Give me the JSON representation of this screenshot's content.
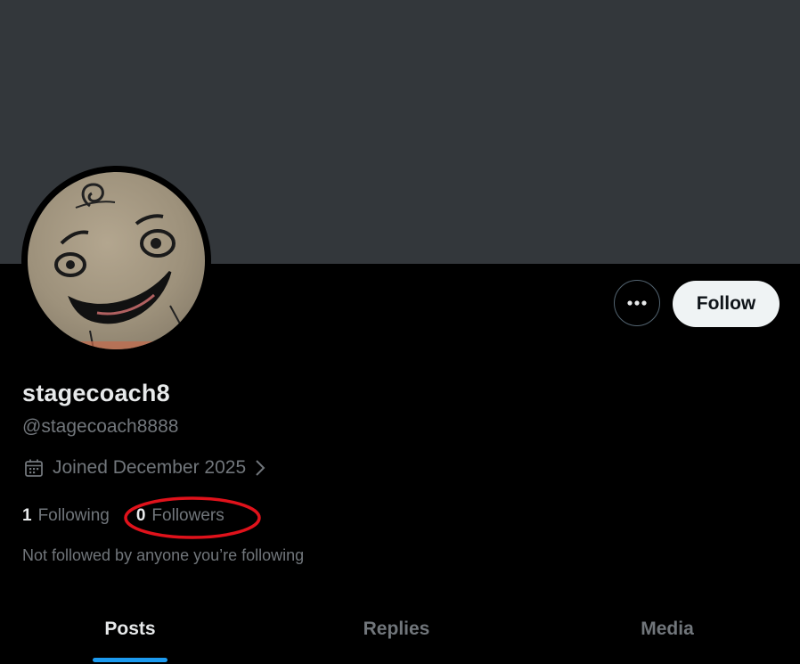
{
  "profile": {
    "display_name": "stagecoach8",
    "handle": "@stagecoach8888",
    "joined": "Joined December 2025",
    "following_count": "1",
    "following_label": "Following",
    "followers_count": "0",
    "followers_label": "Followers",
    "not_followed_note": "Not followed by anyone you’re following"
  },
  "actions": {
    "more_icon": "more-dots-icon",
    "follow_label": "Follow"
  },
  "tabs": [
    {
      "label": "Posts",
      "active": true
    },
    {
      "label": "Replies",
      "active": false
    },
    {
      "label": "Media",
      "active": false
    }
  ],
  "colors": {
    "banner": "#33373b",
    "background": "#000000",
    "accent": "#1d9bf0",
    "annotation": "#e0121b",
    "secondary_text": "#71767b"
  },
  "icons": {
    "joined": "calendar-icon",
    "joined_chevron": "chevron-right-icon"
  }
}
